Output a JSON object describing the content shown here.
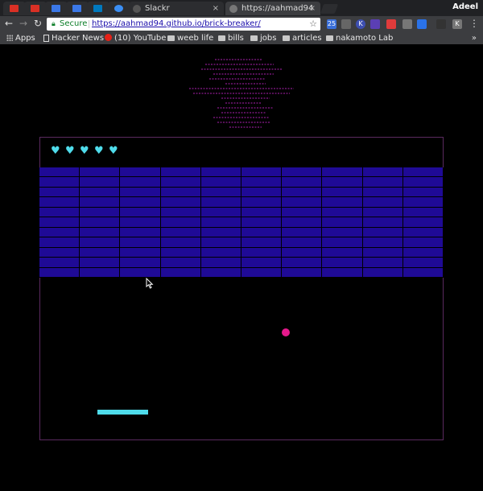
{
  "browser": {
    "tabs": [
      {
        "title": "Slackr",
        "active": false
      },
      {
        "title": "https://aahmad94",
        "active": true
      }
    ],
    "profile_name": "Adeel",
    "omnibox": {
      "security_label": "Secure",
      "url": "https://aahmad94.github.io/brick-breaker/"
    },
    "extensions": [
      "25",
      "K",
      "K"
    ],
    "bookmarks": [
      {
        "label": "Apps",
        "icon": "apps-grid-icon"
      },
      {
        "label": "Hacker News",
        "icon": "page-icon"
      },
      {
        "label": "(10) YouTube",
        "icon": "youtube-icon"
      },
      {
        "label": "weeb life",
        "icon": "folder-icon"
      },
      {
        "label": "bills",
        "icon": "folder-icon"
      },
      {
        "label": "jobs",
        "icon": "folder-icon"
      },
      {
        "label": "articles",
        "icon": "folder-icon"
      },
      {
        "label": "nakamoto Lab",
        "icon": "folder-icon"
      }
    ],
    "overflow_label": "»"
  },
  "game": {
    "lives": 5,
    "life_symbol": "♥",
    "brick_rows": 11,
    "brick_cols": 10,
    "colors": {
      "brick": "#1f0a96",
      "ball": "#e6198c",
      "paddle": "#4fdceb",
      "hearts": "#4fdceb",
      "arena_border": "#5a2a5f",
      "ascii_art": "#8a1a8c"
    }
  }
}
